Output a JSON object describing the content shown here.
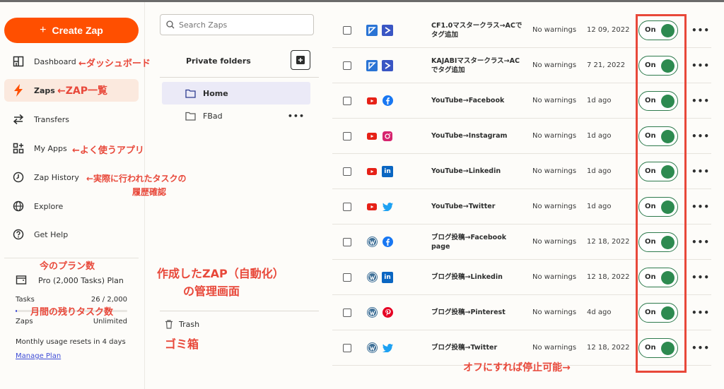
{
  "sidebar": {
    "create_label": "Create Zap",
    "nav": [
      {
        "label": "Dashboard",
        "icon": "dashboard-icon"
      },
      {
        "label": "Zaps",
        "icon": "zap-icon",
        "active": true
      },
      {
        "label": "Transfers",
        "icon": "transfers-icon"
      },
      {
        "label": "My Apps",
        "icon": "apps-icon"
      },
      {
        "label": "Zap History",
        "icon": "history-icon"
      },
      {
        "label": "Explore",
        "icon": "globe-icon"
      },
      {
        "label": "Get Help",
        "icon": "help-icon"
      }
    ],
    "plan_name": "Pro (2,000 Tasks) Plan",
    "tasks_label": "Tasks",
    "tasks_value": "26 / 2,000",
    "tasks_fraction": 0.013,
    "zaps_label": "Zaps",
    "zaps_value": "Unlimited",
    "reset_text": "Monthly usage resets in 4 days",
    "manage_label": "Manage Plan"
  },
  "folders": {
    "search_placeholder": "Search Zaps",
    "title": "Private folders",
    "items": [
      {
        "label": "Home",
        "active": true
      },
      {
        "label": "FBad",
        "active": false
      }
    ],
    "trash_label": "Trash"
  },
  "zaps": [
    {
      "name": "CF1.0マスタークラス→ACでタグ追加",
      "apps": [
        "kajabi",
        "activecampaign"
      ],
      "status": "No warnings",
      "date": "12 09, 2022",
      "toggle": "On"
    },
    {
      "name": "KAJABIマスタークラス→ACでタグ追加",
      "apps": [
        "kajabi",
        "activecampaign"
      ],
      "status": "No warnings",
      "date": "7 21, 2022",
      "toggle": "On"
    },
    {
      "name": "YouTube→Facebook",
      "apps": [
        "youtube",
        "facebook"
      ],
      "status": "No warnings",
      "date": "1d ago",
      "toggle": "On"
    },
    {
      "name": "YouTube→Instagram",
      "apps": [
        "youtube",
        "instagram"
      ],
      "status": "No warnings",
      "date": "1d ago",
      "toggle": "On"
    },
    {
      "name": "YouTube→Linkedin",
      "apps": [
        "youtube",
        "linkedin"
      ],
      "status": "No warnings",
      "date": "1d ago",
      "toggle": "On"
    },
    {
      "name": "YouTube→Twitter",
      "apps": [
        "youtube",
        "twitter"
      ],
      "status": "No warnings",
      "date": "1d ago",
      "toggle": "On"
    },
    {
      "name": "ブログ投稿→Facebook page",
      "apps": [
        "wordpress",
        "facebook"
      ],
      "status": "No warnings",
      "date": "12 18, 2022",
      "toggle": "On"
    },
    {
      "name": "ブログ投稿→Linkedin",
      "apps": [
        "wordpress",
        "linkedin"
      ],
      "status": "No warnings",
      "date": "12 18, 2022",
      "toggle": "On"
    },
    {
      "name": "ブログ投稿→Pinterest",
      "apps": [
        "wordpress",
        "pinterest"
      ],
      "status": "No warnings",
      "date": "4d ago",
      "toggle": "On"
    },
    {
      "name": "ブログ投稿→Twitter",
      "apps": [
        "wordpress",
        "twitter"
      ],
      "status": "No warnings",
      "date": "12 18, 2022",
      "toggle": "On"
    }
  ],
  "annotations": {
    "dashboard": "←ダッシュボード",
    "zaps": "←ZAP一覧",
    "myapps": "←よく使うアプリ",
    "history_1": "←実際に行われたタスクの",
    "history_2": "履歴確認",
    "plan": "今のプラン数",
    "usage": "月間の残りタスク数",
    "manage_1": "作成したZAP（自動化）",
    "manage_2": "の管理画面",
    "trash": "ゴミ箱",
    "toggle": "オフにすれば停止可能→"
  },
  "colors": {
    "accent": "#ff4f00",
    "annotation": "#e8483a",
    "toggle_on": "#2d8a50"
  }
}
